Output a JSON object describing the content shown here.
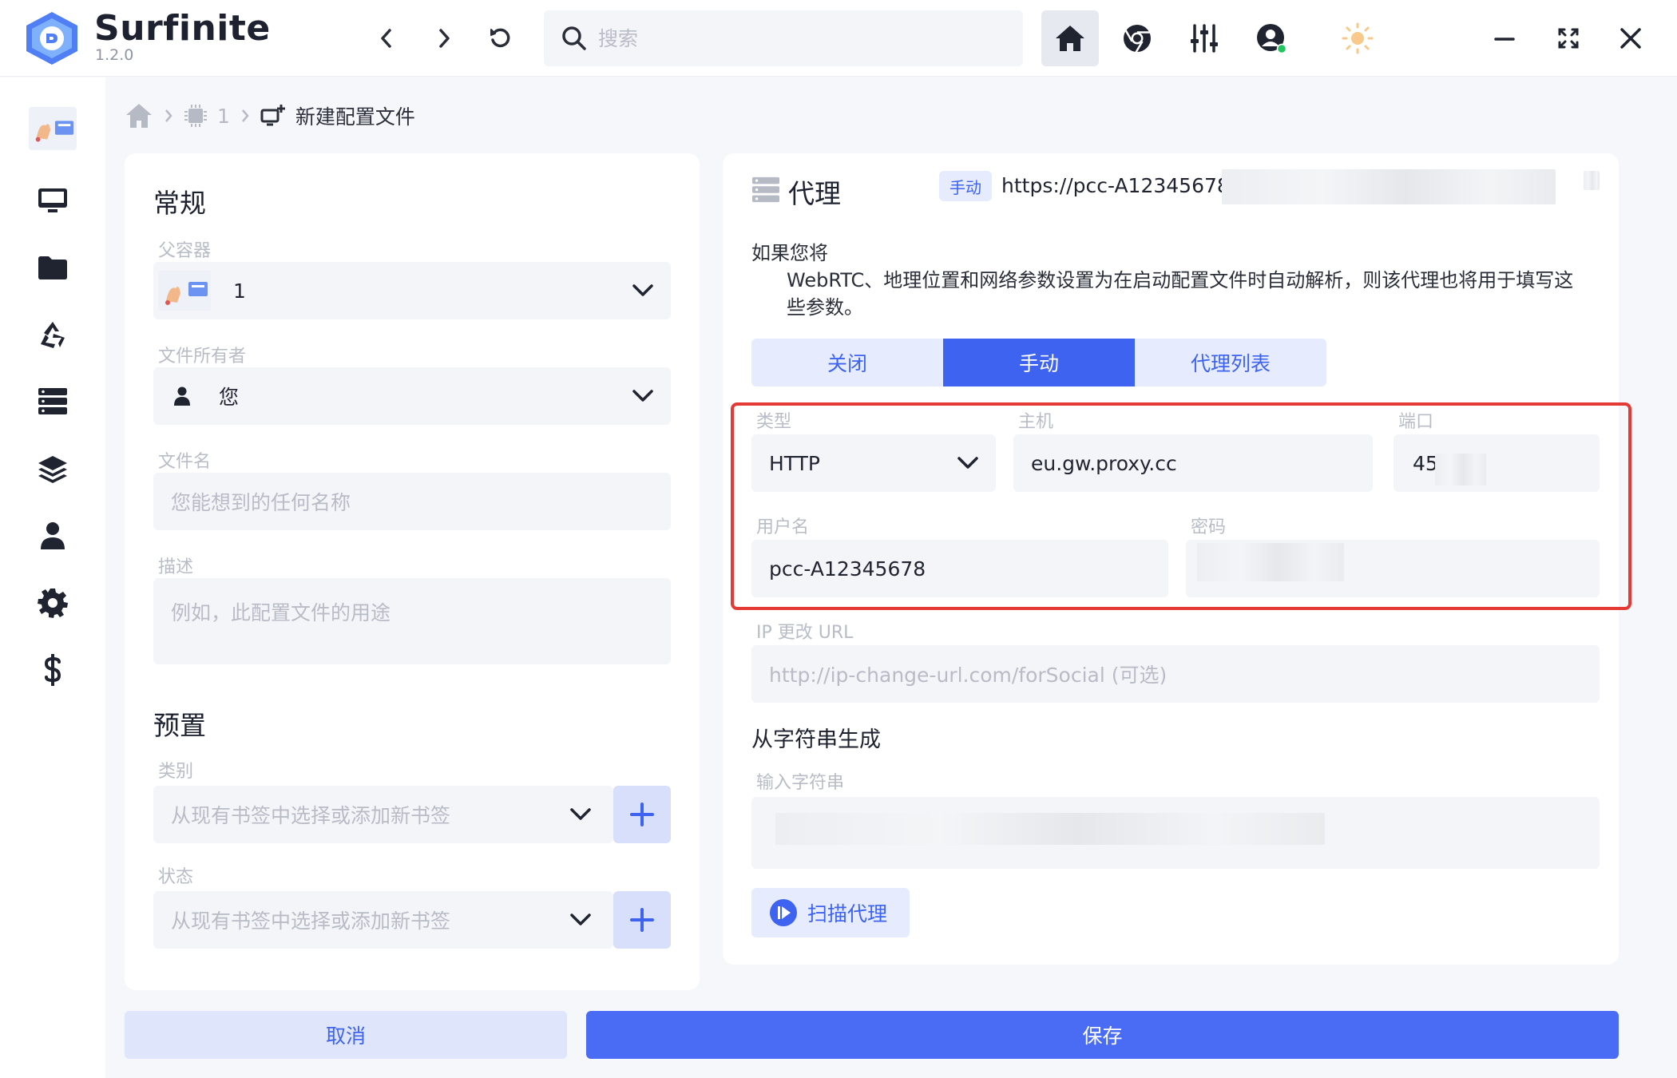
{
  "app": {
    "name": "Surfinite",
    "version": "1.2.0"
  },
  "search": {
    "placeholder": "搜索"
  },
  "breadcrumb": {
    "container": "1",
    "current": "新建配置文件"
  },
  "general": {
    "title": "常规",
    "parent_label": "父容器",
    "parent_value": "1",
    "owner_label": "文件所有者",
    "owner_value": "您",
    "filename_label": "文件名",
    "filename_placeholder": "您能想到的任何名称",
    "desc_label": "描述",
    "desc_placeholder": "例如，此配置文件的用途"
  },
  "preset": {
    "title": "预置",
    "category_label": "类别",
    "category_placeholder": "从现有书签中选择或添加新书签",
    "status_label": "状态",
    "status_placeholder": "从现有书签中选择或添加新书签"
  },
  "proxy": {
    "title": "代理",
    "mode_tag": "手动",
    "url": "https://pcc-A12345678",
    "desc_line1": "如果您将",
    "desc_line2": "WebRTC、地理位置和网络参数设置为在启动配置文件时自动解析，则该代理也将用于填写这些参数。",
    "tabs": [
      "关闭",
      "手动",
      "代理列表"
    ],
    "type_label": "类型",
    "type_value": "HTTP",
    "host_label": "主机",
    "host_value": "eu.gw.proxy.cc",
    "port_label": "端口",
    "port_value": "45",
    "username_label": "用户名",
    "username_value": "pcc-A12345678",
    "password_label": "密码",
    "ipchange_label": "IP 更改 URL",
    "ipchange_placeholder": "http://ip-change-url.com/forSocial (可选)",
    "fromstring_title": "从字符串生成",
    "fromstring_label": "输入字符串",
    "scan_label": "扫描代理"
  },
  "footer": {
    "cancel": "取消",
    "save": "保存"
  },
  "colors": {
    "accent": "#3e63f0",
    "highlight": "#e53935",
    "online": "#22c55e"
  },
  "icons": [
    "back-icon",
    "forward-icon",
    "refresh-icon",
    "search-icon",
    "home-icon",
    "chrome-icon",
    "sliders-icon",
    "account-icon",
    "sun-icon",
    "minimize-icon",
    "fullscreen-icon",
    "close-icon",
    "monitor-icon",
    "folder-icon",
    "recycle-icon",
    "server-icon",
    "layers-icon",
    "user-icon",
    "gear-icon",
    "dollar-icon"
  ]
}
